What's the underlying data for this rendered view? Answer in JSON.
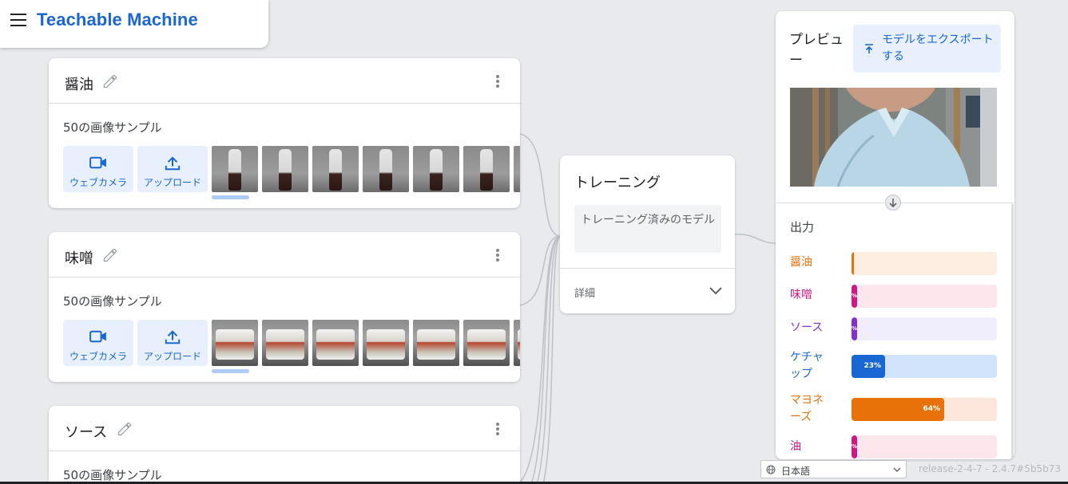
{
  "app": {
    "title": "Teachable Machine"
  },
  "classes": [
    {
      "name": "醤油",
      "sample_count": "50の画像サンプル",
      "webcam_label": "ウェブカメラ",
      "upload_label": "アップロード"
    },
    {
      "name": "味噌",
      "sample_count": "50の画像サンプル",
      "webcam_label": "ウェブカメラ",
      "upload_label": "アップロード"
    },
    {
      "name": "ソース",
      "sample_count": "50の画像サンプル"
    }
  ],
  "training": {
    "title": "トレーニング",
    "button_label": "トレーニング済みのモデル",
    "details_label": "詳細"
  },
  "preview": {
    "title": "プレビュー",
    "export_label": "モデルをエクスポートする",
    "output_title": "出力",
    "outputs": [
      {
        "label": "醤油",
        "value": 0.01,
        "percent_text": "",
        "color": "#e8710a",
        "track": "#fdeee1"
      },
      {
        "label": "味噌",
        "value": 0.04,
        "percent_text": "%",
        "color": "#d01884",
        "track": "#fde7ec"
      },
      {
        "label": "ソース",
        "value": 0.04,
        "percent_text": "%",
        "color": "#8430ce",
        "track": "#f0edfc"
      },
      {
        "label": "ケチャップ",
        "value": 0.23,
        "percent_text": "23%",
        "color": "#1967d2",
        "track": "#d2e3fc"
      },
      {
        "label": "マヨネーズ",
        "value": 0.64,
        "percent_text": "64%",
        "color": "#e8710a",
        "track": "#fde7dc"
      },
      {
        "label": "油",
        "value": 0.04,
        "percent_text": "%",
        "color": "#d01884",
        "track": "#fde7ec"
      }
    ]
  },
  "footer": {
    "language": "日本語",
    "version": "release-2-4-7 - 2.4.7#5b5b73"
  }
}
